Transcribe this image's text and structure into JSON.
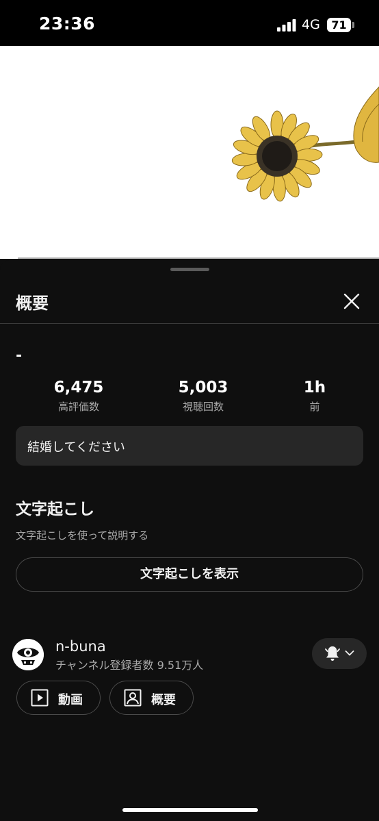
{
  "status_bar": {
    "time": "23:36",
    "network": "4G",
    "battery": "71",
    "icons": [
      "signal-icon",
      "battery-icon"
    ]
  },
  "video": {
    "thumbnail_icon": "sunflower-illustration"
  },
  "sheet": {
    "title": "概要",
    "close_icon": "close-icon",
    "video_title": "-",
    "stats": [
      {
        "value": "6,475",
        "label": "高評価数"
      },
      {
        "value": "5,003",
        "label": "視聴回数"
      },
      {
        "value": "1h",
        "label": "前"
      }
    ],
    "description": "結婚してください",
    "transcript": {
      "heading": "文字起こし",
      "subtext": "文字起こしを使って説明する",
      "button_label": "文字起こしを表示"
    },
    "channel": {
      "name": "n-buna",
      "subscribers": "チャンネル登録者数 9.51万人",
      "bell_icon": "bell-icon",
      "videos_button": "動画",
      "about_button": "概要"
    }
  },
  "colors": {
    "background": "#0f0f0f",
    "surface": "#272727",
    "text_primary": "#f1f1f1",
    "text_secondary": "#aaaaaa"
  }
}
